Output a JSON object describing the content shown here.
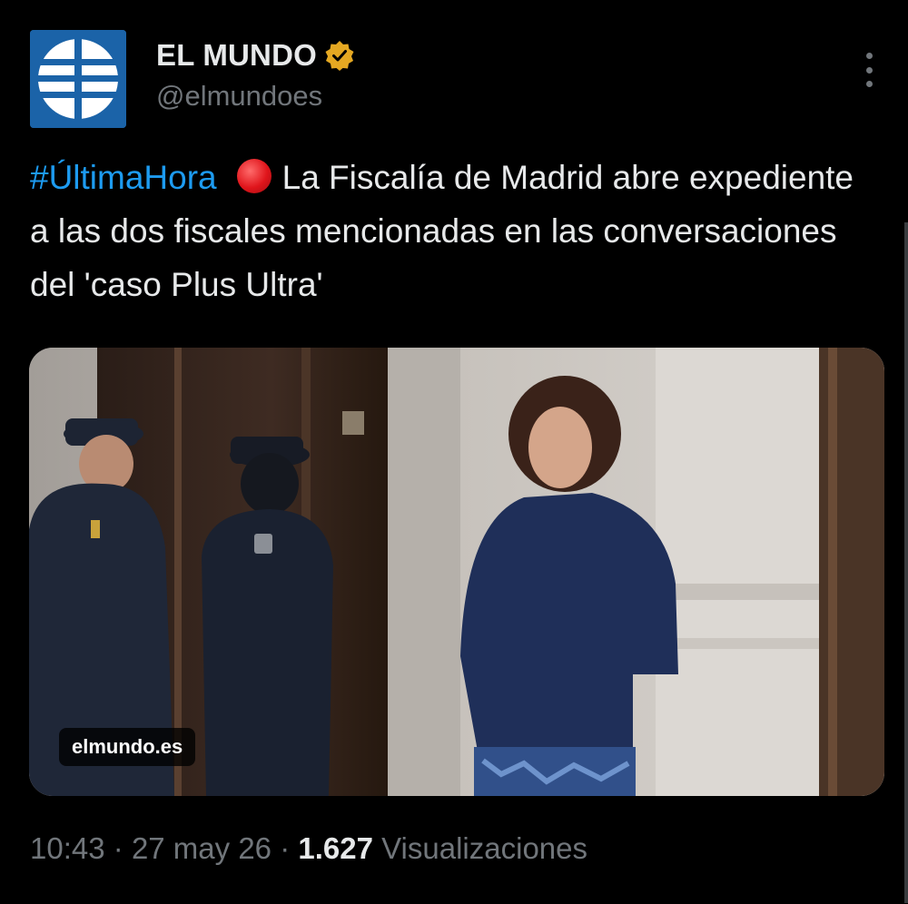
{
  "author": {
    "display_name": "EL MUNDO",
    "handle": "@elmundoes",
    "verified_badge_color": "#e5a822",
    "avatar_icon": "el-mundo-logo-icon",
    "avatar_color": "#1b63a8"
  },
  "tweet": {
    "hashtag": "#ÚltimaHora",
    "text": "La Fiscalía de Madrid abre expediente a las dos fiscales mencionadas en las conversaciones del 'caso Plus Ultra'",
    "emoji_icon": "red-circle-icon"
  },
  "media": {
    "source_label": "elmundo.es"
  },
  "meta": {
    "time": "10:43",
    "separator": "·",
    "date": "27 may 26",
    "views_count": "1.627",
    "views_label": "Visualizaciones"
  },
  "colors": {
    "background": "#000000",
    "text": "#e7e9ea",
    "secondary": "#71767b",
    "link": "#1d9bf0"
  }
}
